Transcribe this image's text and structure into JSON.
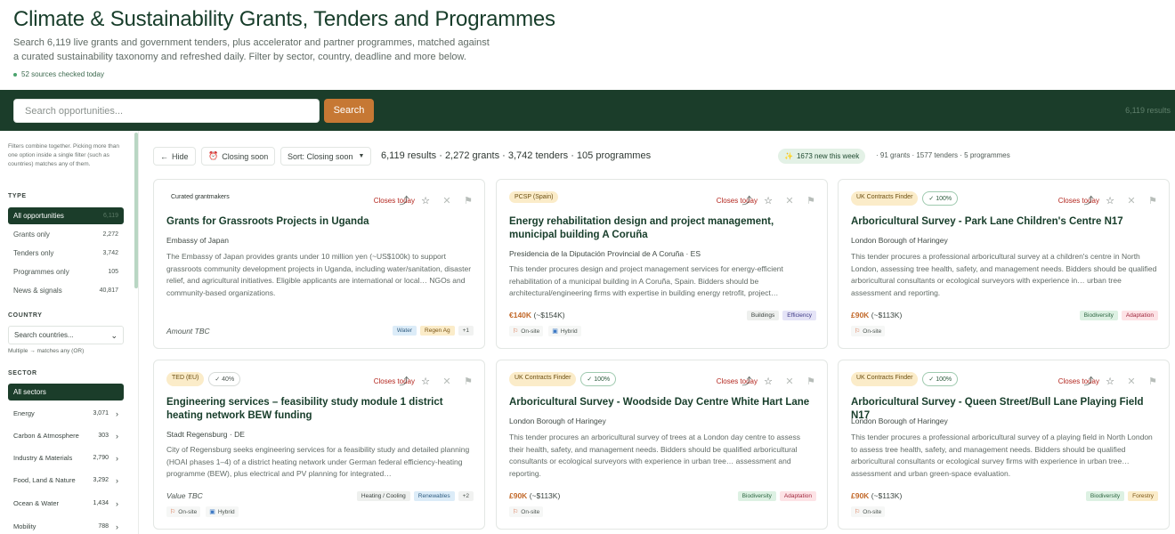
{
  "header": {
    "title": "Climate & Sustainability Grants, Tenders and Programmes",
    "subtitle": "Search 6,119 live grants and government tenders, plus accelerator and partner programmes, matched against a curated sustainability taxonomy and refreshed daily. Filter by sector, country, deadline and more below.",
    "sources": "52 sources checked today"
  },
  "search": {
    "placeholder": "Search opportunities...",
    "button": "Search",
    "count": "6,119 results"
  },
  "sidebar": {
    "hint": "Filters combine together. Picking more than one option inside a single filter (such as countries) matches any of them.",
    "type_label": "TYPE",
    "types": [
      {
        "label": "All opportunities",
        "count": "6,119"
      },
      {
        "label": "Grants only",
        "count": "2,272"
      },
      {
        "label": "Tenders only",
        "count": "3,742"
      },
      {
        "label": "Programmes only",
        "count": "105"
      },
      {
        "label": "News & signals",
        "count": "40,817"
      }
    ],
    "country_label": "COUNTRY",
    "country_placeholder": "Search countries...",
    "country_note": "Multiple → matches any (OR)",
    "sector_label": "SECTOR",
    "all_sectors": "All sectors",
    "sectors": [
      {
        "label": "Energy",
        "count": "3,071"
      },
      {
        "label": "Carbon & Atmosphere",
        "count": "303"
      },
      {
        "label": "Industry & Materials",
        "count": "2,790"
      },
      {
        "label": "Food, Land & Nature",
        "count": "3,292"
      },
      {
        "label": "Ocean & Water",
        "count": "1,434"
      },
      {
        "label": "Mobility",
        "count": "788"
      }
    ]
  },
  "toolbar": {
    "hide": "Hide",
    "closing_soon": "Closing soon",
    "sort": "Sort: Closing soon",
    "results_summary": "6,119 results · 2,272 grants · 3,742 tenders · 105 programmes",
    "new_this_week": "1673 new this week",
    "new_summary": "· 91 grants · 1577 tenders · 5 programmes"
  },
  "cards": [
    {
      "source": "Curated grantmakers",
      "match": "",
      "deadline": "Closes today",
      "title": "Grants for Grassroots Projects in Uganda",
      "org": "Embassy of Japan",
      "desc": "The Embassy of Japan provides grants under 10 million yen (~US$100k) to support grassroots community development projects in Uganda, including water/sanitation, disaster relief, and agricultural initiatives. Eligible applicants are international or local…",
      "desc2": "NGOs and community-based organizations.",
      "amount": "Amount TBC",
      "amount_approx": "",
      "tags": [
        "Water",
        "Regen Ag",
        "+1"
      ],
      "modes": []
    },
    {
      "source": "PCSP (Spain)",
      "match": "",
      "deadline": "Closes today",
      "title": "Energy rehabilitation design and project management, municipal building A Coruña",
      "org": "Presidencia de la Diputación Provincial de A Coruña · ES",
      "desc": "This tender procures design and project management services for energy-efficient rehabilitation of a municipal building in A Coruña, Spain. Bidders should be architectural/engineering firms with expertise in building energy retrofit, project…",
      "desc2": "",
      "amount": "€140K",
      "amount_approx": "(~$154K)",
      "tags": [
        "Buildings",
        "Efficiency"
      ],
      "modes": [
        "On-site",
        "Hybrid"
      ]
    },
    {
      "source": "UK Contracts Finder",
      "match": "✓ 100%",
      "deadline": "Closes today",
      "title": "Arboricultural Survey - Park Lane Children's Centre N17",
      "org": "London Borough of Haringey",
      "desc": "This tender procures a professional arboricultural survey at a children's centre in North London, assessing tree health, safety, and management needs. Bidders should be qualified arboricultural consultants or ecological surveyors with experience in…",
      "desc2": "urban tree assessment and reporting.",
      "amount": "£90K",
      "amount_approx": "(~$113K)",
      "tags": [
        "Biodiversity",
        "Adaptation"
      ],
      "modes": [
        "On-site"
      ]
    },
    {
      "source": "TED (EU)",
      "match": "✓ 40%",
      "deadline": "Closes today",
      "title": "Engineering services – feasibility study module 1 district heating network BEW funding",
      "org": "Stadt Regensburg · DE",
      "desc": "City of Regensburg seeks engineering services for a feasibility study and detailed planning (HOAI phases 1–4) of a district heating network under German federal efficiency-heating programme (BEW), plus electrical and PV planning for integrated…",
      "desc2": "",
      "amount": "Value TBC",
      "amount_approx": "",
      "tags": [
        "Heating / Cooling",
        "Renewables",
        "+2"
      ],
      "modes": [
        "On-site",
        "Hybrid"
      ]
    },
    {
      "source": "UK Contracts Finder",
      "match": "✓ 100%",
      "deadline": "Closes today",
      "title": "Arboricultural Survey - Woodside Day Centre White Hart Lane",
      "org": "London Borough of Haringey",
      "desc": "This tender procures an arboricultural survey of trees at a London day centre to assess their health, safety, and management needs. Bidders should be qualified arboricultural consultants or ecological surveyors with experience in urban tree…",
      "desc2": "assessment and reporting.",
      "amount": "£90K",
      "amount_approx": "(~$113K)",
      "tags": [
        "Biodiversity",
        "Adaptation"
      ],
      "modes": [
        "On-site"
      ]
    },
    {
      "source": "UK Contracts Finder",
      "match": "✓ 100%",
      "deadline": "Closes today",
      "title": "Arboricultural Survey - Queen Street/Bull Lane Playing Field N17",
      "org": "London Borough of Haringey",
      "desc": "This tender procures a professional arboricultural survey of a playing field in North London to assess tree health, safety, and management needs. Bidders should be qualified arboricultural consultants or ecological survey firms with experience in urban tree…",
      "desc2": "assessment and urban green-space evaluation.",
      "amount": "£90K",
      "amount_approx": "(~$113K)",
      "tags": [
        "Biodiversity",
        "Forestry"
      ],
      "modes": [
        "On-site"
      ]
    }
  ]
}
